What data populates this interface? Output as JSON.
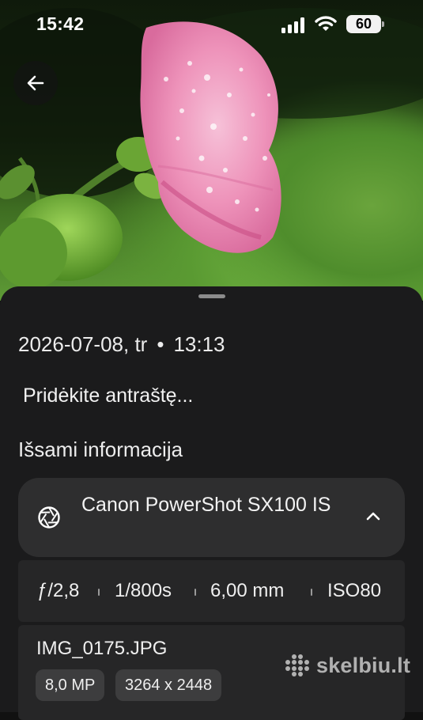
{
  "status_bar": {
    "time": "15:42",
    "battery_level": "60"
  },
  "viewer": {
    "back_icon": "arrow-left-icon"
  },
  "info": {
    "datetime": {
      "date": "2026-07-08, tr",
      "time": "13:13"
    },
    "caption_placeholder": "Pridėkite antraštę...",
    "details_title": "Išsami informacija",
    "camera": {
      "model": "Canon PowerShot SX100 IS",
      "icon": "aperture-icon",
      "expand_icon": "chevron-up-icon"
    },
    "exif": {
      "aperture": "ƒ/2,8",
      "shutter": "1/800s",
      "focal_length": "6,00 mm",
      "iso": "ISO80"
    },
    "file": {
      "name": "IMG_0175.JPG",
      "megapixels": "8,0 MP",
      "resolution": "3264 x 2448"
    }
  },
  "watermark": {
    "text": "skelbiu.lt"
  },
  "colors": {
    "sheet_bg": "#1b1b1c",
    "card_bg": "#2e2e2f",
    "chip_bg": "#3d3d3e"
  }
}
